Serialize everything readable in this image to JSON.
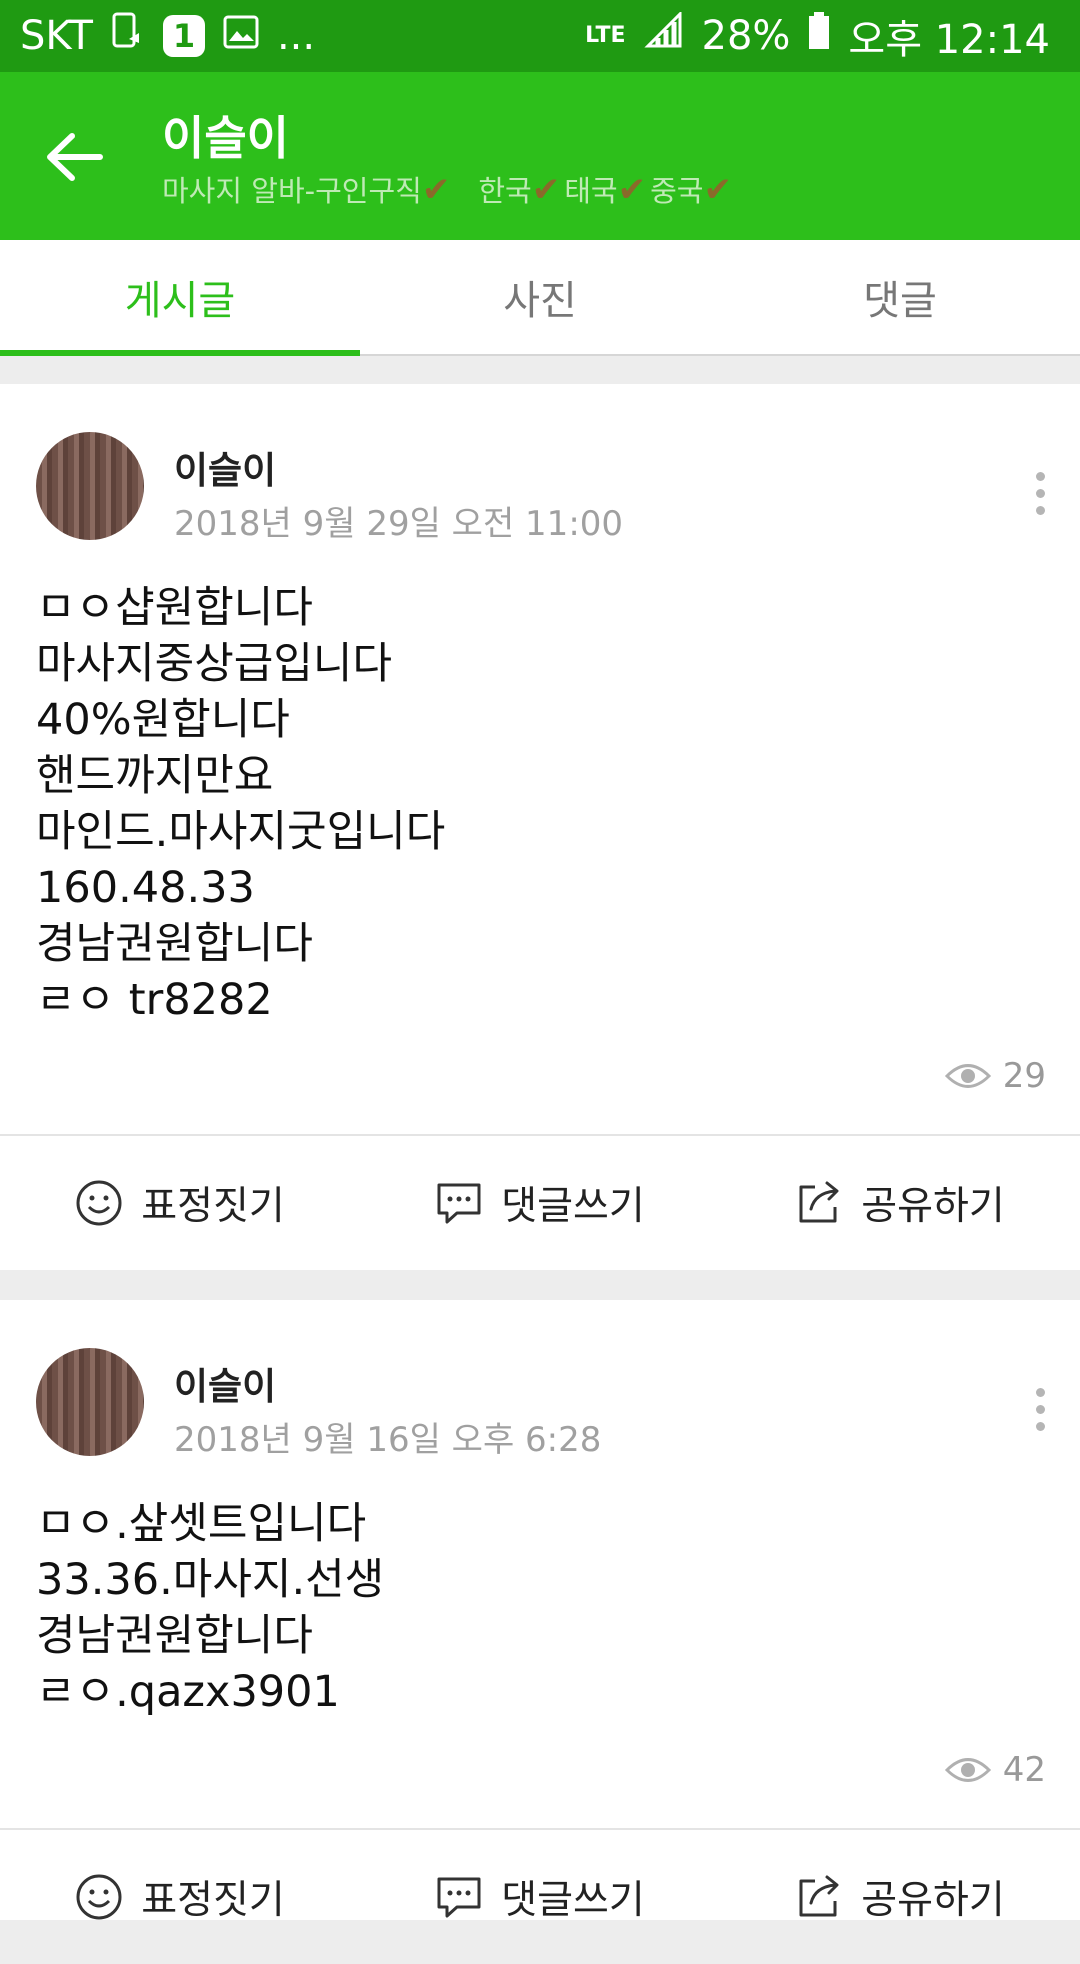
{
  "status_bar": {
    "carrier": "SKT",
    "badge": "1",
    "more": "...",
    "network": "LTE",
    "battery": "28%",
    "time": "오후 12:14"
  },
  "header": {
    "title": "이슬이",
    "subtitle_parts": [
      "마사지 알바-구인구직",
      "한국",
      "태국",
      "중국"
    ]
  },
  "tabs": [
    {
      "label": "게시글",
      "active": true
    },
    {
      "label": "사진",
      "active": false
    },
    {
      "label": "댓글",
      "active": false
    }
  ],
  "posts": [
    {
      "author": "이슬이",
      "date": "2018년 9월 29일 오전 11:00",
      "body": "ㅁㅇ샵원합니다\n마사지중상급입니다\n40%원합니다\n핸드까지만요\n마인드.마사지굿입니다\n160.48.33\n경남권원합니다\nㄹㅇ tr8282",
      "views": "29"
    },
    {
      "author": "이슬이",
      "date": "2018년 9월 16일 오후 6:28",
      "body": "ㅁㅇ.샆셋트입니다\n33.36.마사지.선생\n경남권원합니다\nㄹㅇ.qazx3901",
      "views": "42"
    }
  ],
  "actions": {
    "react": "표정짓기",
    "comment": "댓글쓰기",
    "share": "공유하기"
  },
  "colors": {
    "header_green": "#2dbf1b",
    "status_green": "#1f9a12",
    "check_brown": "#8a6a2a"
  }
}
